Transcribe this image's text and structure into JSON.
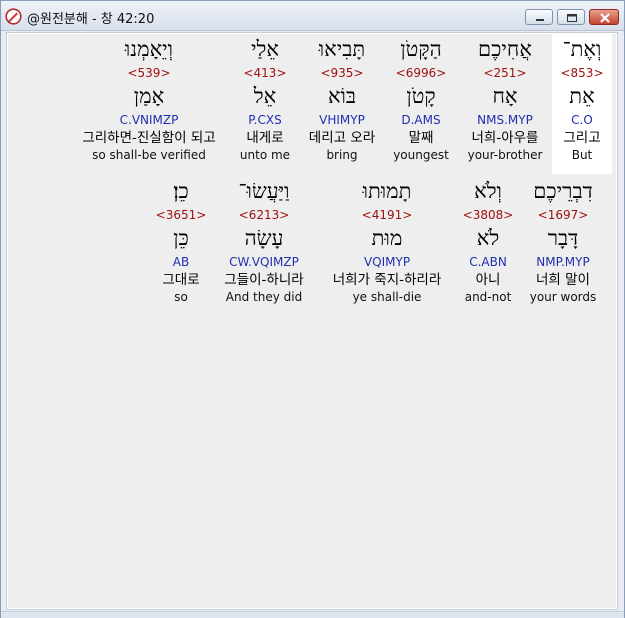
{
  "window": {
    "title": "@원전분해 - 창 42:20",
    "icon": "bible-app-icon",
    "buttons": [
      "minimize",
      "maximize",
      "close"
    ]
  },
  "rows": [
    {
      "words": [
        {
          "hebrew": "וְיֵאָמְנוּ",
          "strong": "<539>",
          "lexeme": "אָמַן",
          "morph": "C.VNIMZP",
          "korean": "그리하면-진실함이 되고",
          "english": "so shall-be verified"
        },
        {
          "hebrew": "אֵלַי",
          "strong": "<413>",
          "lexeme": "אֵל",
          "morph": "P.CXS",
          "korean": "내게로",
          "english": "unto me"
        },
        {
          "hebrew": "תָּבִיאוּ",
          "strong": "<935>",
          "lexeme": "בּוֹא",
          "morph": "VHIMYP",
          "korean": "데리고 오라",
          "english": "bring"
        },
        {
          "hebrew": "הַקָּטֹן",
          "strong": "<6996>",
          "lexeme": "קָטֹן",
          "morph": "D.AMS",
          "korean": "말째",
          "english": "youngest"
        },
        {
          "hebrew": "אֲחִיכֶם",
          "strong": "<251>",
          "lexeme": "אָח",
          "morph": "NMS.MYP",
          "korean": "너희-아우를",
          "english": "your-brother"
        },
        {
          "hebrew": "וְאֶת־",
          "strong": "<853>",
          "lexeme": "אֵת",
          "morph": "C.O",
          "korean": "그리고",
          "english": "But"
        }
      ]
    },
    {
      "words": [
        {
          "hebrew": "כֵן׃",
          "strong": "<3651>",
          "lexeme": "כֵּן",
          "morph": "AB",
          "korean": "그대로",
          "english": "so"
        },
        {
          "hebrew": "וַיַּעֲשׂוּ־",
          "strong": "<6213>",
          "lexeme": "עָשָׂה",
          "morph": "CW.VQIMZP",
          "korean": "그들이-하니라",
          "english": "And they did"
        },
        {
          "hebrew": "תָמוּתוּ",
          "strong": "<4191>",
          "lexeme": "מוּת",
          "morph": "VQIMYP",
          "korean": "너희가 죽지-하리라",
          "english": "ye shall-die"
        },
        {
          "hebrew": "וְלֹא",
          "strong": "<3808>",
          "lexeme": "לֹא",
          "morph": "C.ABN",
          "korean": "아니",
          "english": "and-not"
        },
        {
          "hebrew": "דִבְרֵיכֶם",
          "strong": "<1697>",
          "lexeme": "דָּבָר",
          "morph": "NMP.MYP",
          "korean": "너희 말이",
          "english": "your words"
        }
      ]
    }
  ],
  "colors": {
    "strong": "#a01010",
    "morph": "#1f2fb0",
    "selected_background": "#ffffff",
    "pane_background": "#eeeeee"
  },
  "selected_word": "וְאֶת־"
}
